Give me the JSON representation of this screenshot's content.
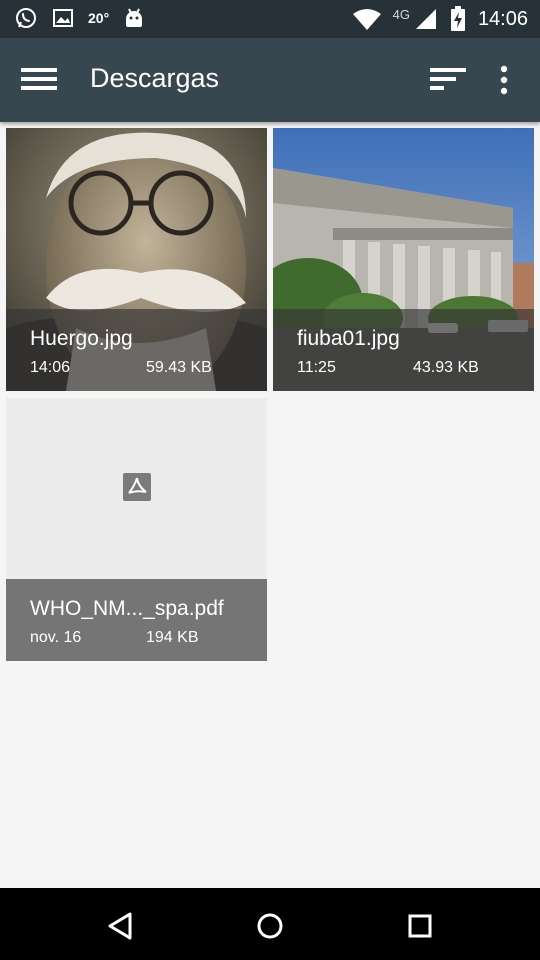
{
  "status_bar": {
    "temperature": "20°",
    "network": "4G",
    "time": "14:06",
    "icons": [
      "whatsapp-icon",
      "image-icon",
      "android-debug-icon",
      "wifi-icon",
      "signal-icon",
      "battery-charging-icon"
    ]
  },
  "toolbar": {
    "title": "Descargas",
    "icons": [
      "hamburger-menu-icon",
      "sort-icon",
      "more-vert-icon"
    ]
  },
  "files": [
    {
      "name": "Huergo.jpg",
      "date": "14:06",
      "size": "59.43 KB",
      "thumbnail": "portrait-photo"
    },
    {
      "name": "fiuba01.jpg",
      "date": "11:25",
      "size": "43.93 KB",
      "thumbnail": "building-photo"
    },
    {
      "name": "WHO_NM..._spa.pdf",
      "date": "nov. 16",
      "size": "194 KB",
      "thumbnail": "pdf-icon"
    }
  ],
  "nav_bar": {
    "icons": [
      "back-icon",
      "home-icon",
      "recents-icon"
    ]
  },
  "colors": {
    "status_bar": "#263238",
    "toolbar": "#37474f",
    "background": "#f5f5f5",
    "pdf_caption": "#757575",
    "nav_bar": "#000000"
  }
}
